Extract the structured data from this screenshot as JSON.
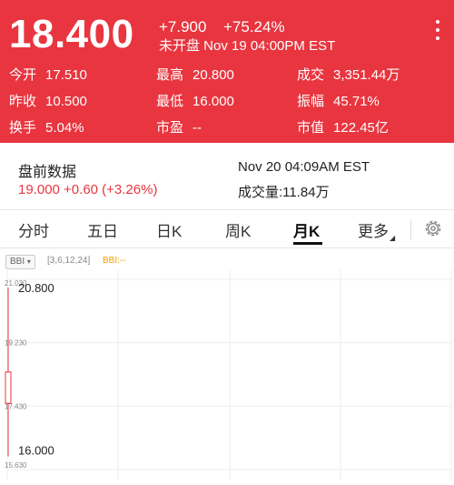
{
  "quote": {
    "price": "18.400",
    "change": "+7.900",
    "change_pct": "+75.24%",
    "session": "未开盘 Nov 19 04:00PM EST",
    "stats": [
      {
        "label": "今开",
        "value": "17.510"
      },
      {
        "label": "最高",
        "value": "20.800"
      },
      {
        "label": "成交",
        "value": "3,351.44万"
      },
      {
        "label": "昨收",
        "value": "10.500"
      },
      {
        "label": "最低",
        "value": "16.000"
      },
      {
        "label": "振幅",
        "value": "45.71%"
      },
      {
        "label": "换手",
        "value": "5.04%"
      },
      {
        "label": "市盈",
        "value": "--"
      },
      {
        "label": "市值",
        "value": "122.45亿"
      }
    ]
  },
  "premarket": {
    "title": "盘前数据",
    "value": "19.000 +0.60 (+3.26%)",
    "time": "Nov 20 04:09AM EST",
    "volume": "成交量:11.84万"
  },
  "tabs": [
    {
      "label": "分时",
      "active": false
    },
    {
      "label": "五日",
      "active": false
    },
    {
      "label": "日K",
      "active": false
    },
    {
      "label": "周K",
      "active": false
    },
    {
      "label": "月K",
      "active": true
    },
    {
      "label": "更多",
      "active": false
    }
  ],
  "indicator": {
    "name": "BBI",
    "params": "[3,6,12,24]",
    "value": "BBI:--"
  },
  "chart_data": {
    "type": "candlestick",
    "period": "月K",
    "y_ticks": [
      "21.030",
      "19.230",
      "17.430",
      "15.630"
    ],
    "ylim": [
      15.63,
      21.03
    ],
    "high_label": "20.800",
    "low_label": "16.000",
    "candles": [
      {
        "open": 17.51,
        "high": 20.8,
        "low": 16.0,
        "close": 18.4
      }
    ],
    "grid": true
  },
  "colors": {
    "header_bg": "#e8353f",
    "up": "#e8353f",
    "indicator": "#f0a000"
  }
}
